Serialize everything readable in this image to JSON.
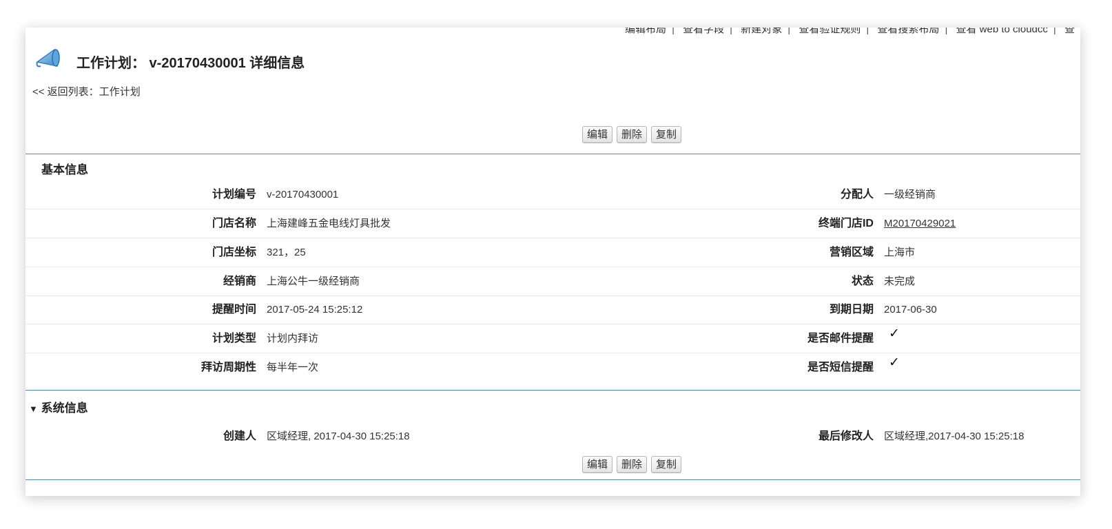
{
  "top_links": [
    "编辑布局",
    "查看字段",
    "新建对象",
    "查看验证规则",
    "查看搜索布局",
    "查看 web to cloudcc",
    "查"
  ],
  "header": {
    "title": "工作计划： v-20170430001  详细信息",
    "back_link": "<< 返回列表：工作计划"
  },
  "buttons": {
    "edit": "编辑",
    "delete": "删除",
    "copy": "复制"
  },
  "basic": {
    "title": "基本信息",
    "rows": [
      {
        "left_label": "计划编号",
        "left_value": "v-20170430001",
        "right_label": "分配人",
        "right_value": "一级经销商"
      },
      {
        "left_label": "门店名称",
        "left_value": "上海建峰五金电线灯具批发",
        "right_label": "终端门店ID",
        "right_value": "M20170429021"
      },
      {
        "left_label": "门店坐标",
        "left_value": "321，25",
        "right_label": "营销区域",
        "right_value": "上海市"
      },
      {
        "left_label": "经销商",
        "left_value": "上海公牛一级经销商",
        "right_label": "状态",
        "right_value": "未完成"
      },
      {
        "left_label": "提醒时间",
        "left_value": "2017-05-24 15:25:12",
        "right_label": "到期日期",
        "right_value": "2017-06-30"
      },
      {
        "left_label": "计划类型",
        "left_value": "计划内拜访",
        "right_label": "是否邮件提醒",
        "right_check": "✓"
      },
      {
        "left_label": "拜访周期性",
        "left_value": "每半年一次",
        "right_label": "是否短信提醒",
        "right_check": "✓"
      }
    ]
  },
  "system": {
    "toggle": "▼",
    "title": "系统信息",
    "created_label": "创建人",
    "created_value": "区域经理, 2017-04-30 15:25:18",
    "modified_label": "最后修改人",
    "modified_value": "区域经理,2017-04-30 15:25:18"
  },
  "colors": {
    "accent_line": "#4a8cc2",
    "icon_blue": "#5aa6e0"
  },
  "icons": {
    "title_icon": "megaphone-icon",
    "checkbox_mark": "checkmark-icon"
  }
}
